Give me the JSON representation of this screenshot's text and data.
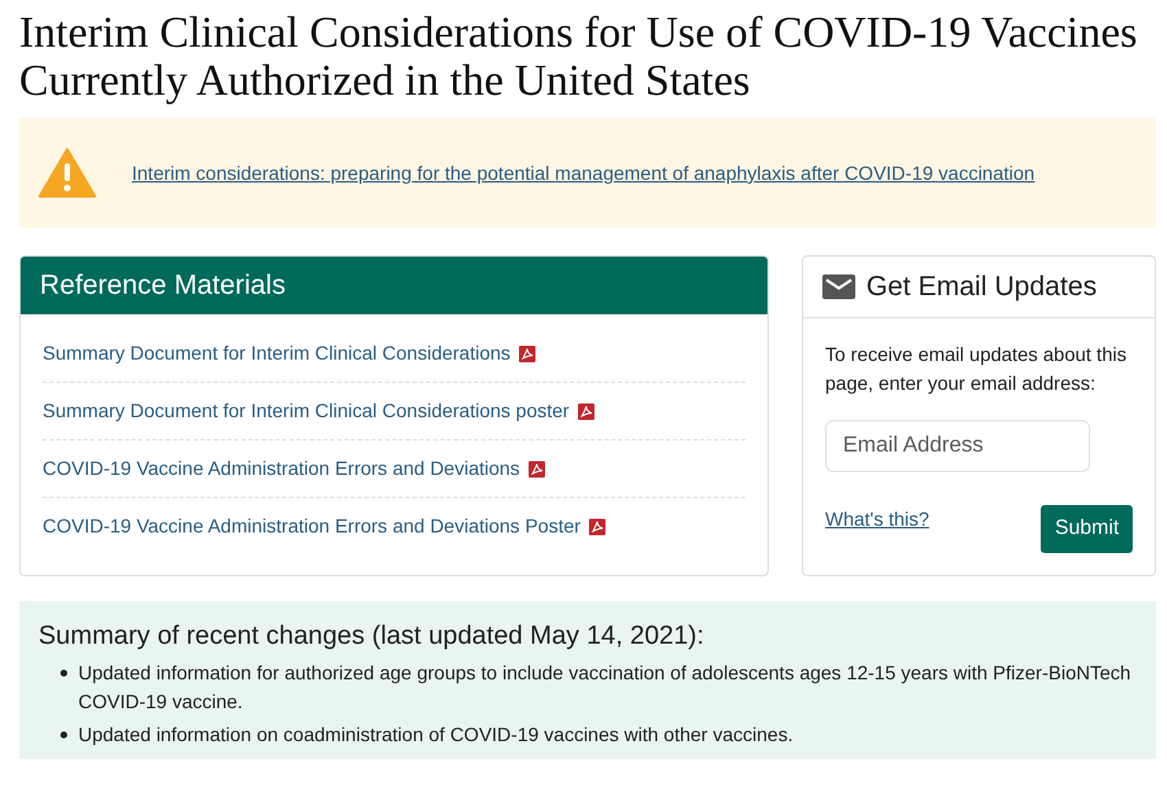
{
  "page_title": "Interim Clinical Considerations for Use of COVID-19 Vaccines Currently Authorized in the United States",
  "alert": {
    "link": "Interim considerations: preparing for the potential management of anaphylaxis after COVID-19 vaccination"
  },
  "reference_materials": {
    "title": "Reference Materials",
    "links": [
      {
        "label": "Summary Document for Interim Clinical Considerations",
        "kind": "pdf"
      },
      {
        "label": "Summary Document for Interim Clinical Considerations poster",
        "kind": "pdf"
      },
      {
        "label": "COVID-19 Vaccine Administration Errors and Deviations",
        "kind": "pdf"
      },
      {
        "label": "COVID-19 Vaccine Administration Errors and Deviations Poster",
        "kind": "pdf"
      }
    ]
  },
  "email_updates": {
    "title": "Get Email Updates",
    "text": "To receive email updates about this page, enter your email address:",
    "placeholder": "Email Address",
    "help_link": "What's this?",
    "button": "Submit"
  },
  "summary": {
    "title": "Summary of recent changes (last updated May 14, 2021):",
    "items": [
      "Updated information for authorized age groups to include vaccination of adolescents ages 12-15 years with Pfizer-BioNTech COVID-19 vaccine.",
      "Updated information on coadministration of COVID-19 vaccines with other vaccines."
    ]
  }
}
